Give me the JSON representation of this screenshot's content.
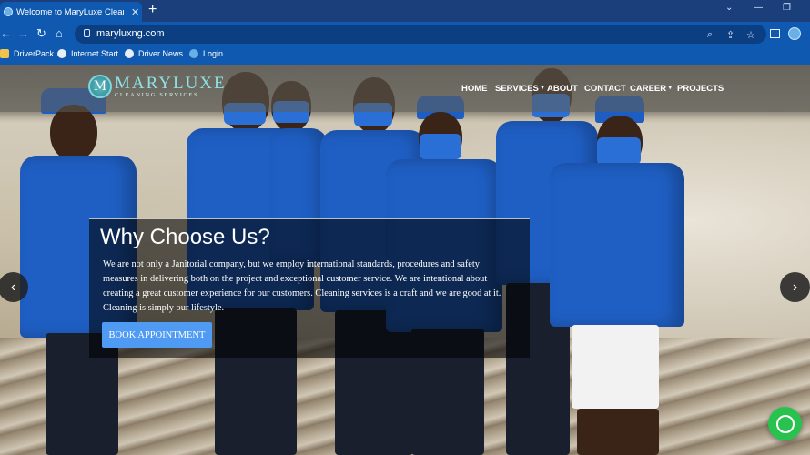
{
  "browser": {
    "tab_title": "Welcome to MaryLuxe Cleaning",
    "tab_close": "✕",
    "new_tab": "+",
    "url": "maryluxng.com",
    "controls": {
      "dropdown": "⌄",
      "minimize": "—",
      "restore": "❐"
    },
    "nav": {
      "back": "←",
      "forward": "→",
      "reload": "↻",
      "home": "⌂"
    },
    "omni_icons": {
      "zoom": "⌕",
      "share": "⇪",
      "star": "☆"
    }
  },
  "bookmarks": [
    {
      "label": "DriverPack",
      "icon": "driverpack-icon"
    },
    {
      "label": "Internet Start",
      "icon": "globe-icon"
    },
    {
      "label": "Driver News",
      "icon": "globe-icon"
    },
    {
      "label": "Login",
      "icon": "site-icon"
    }
  ],
  "site": {
    "logo_name": "MARYLUXE",
    "logo_sub": "CLEANING SERVICES",
    "logo_letter": "M",
    "menu": {
      "home": "HOME",
      "services": "SERVICES",
      "about": "ABOUT",
      "contact": "CONTACT",
      "career": "CAREER",
      "projects": "PROJECTS",
      "caret": "▾"
    },
    "hero": {
      "title": "Why Choose Us?",
      "body": "We are not only a Janitorial company, but we employ international standards, procedures and safety measures in delivering both on the project and exceptional customer service. We are intentional about creating a great customer experience for our customers. Cleaning services is a craft and we are good at it. Cleaning is simply our lifestyle.",
      "button": "BOOK APPOINTMENT",
      "prev": "‹",
      "next": "›"
    }
  },
  "colors": {
    "chrome": "#1b3f7a",
    "toolbar": "#0f5ab0",
    "accent_button": "#4f9af2",
    "logo": "#8ee1e5",
    "whatsapp": "#2ac24f"
  }
}
